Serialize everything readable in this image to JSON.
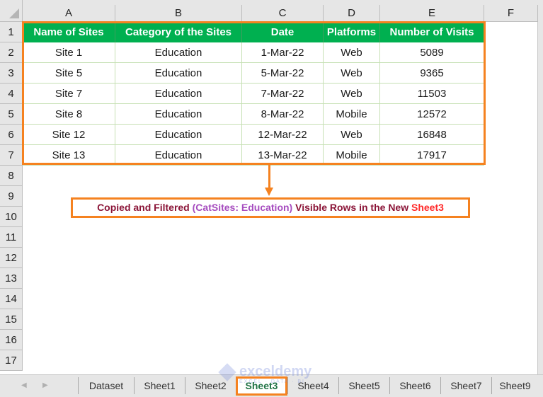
{
  "spreadsheet": {
    "columns": [
      "A",
      "B",
      "C",
      "D",
      "E",
      "F"
    ],
    "rows": [
      "1",
      "2",
      "3",
      "4",
      "5",
      "6",
      "7",
      "8",
      "9",
      "10",
      "11",
      "12",
      "13",
      "14",
      "15",
      "16",
      "17"
    ],
    "table": {
      "headers": [
        "Name of Sites",
        "Category of the Sites",
        "Date",
        "Platforms",
        "Number of Visits"
      ],
      "rows": [
        [
          "Site 1",
          "Education",
          "1-Mar-22",
          "Web",
          "5089"
        ],
        [
          "Site 5",
          "Education",
          "5-Mar-22",
          "Web",
          "9365"
        ],
        [
          "Site 7",
          "Education",
          "7-Mar-22",
          "Web",
          "11503"
        ],
        [
          "Site 8",
          "Education",
          "8-Mar-22",
          "Mobile",
          "12572"
        ],
        [
          "Site 12",
          "Education",
          "12-Mar-22",
          "Web",
          "16848"
        ],
        [
          "Site 13",
          "Education",
          "13-Mar-22",
          "Mobile",
          "17917"
        ]
      ]
    }
  },
  "callout": {
    "part1": "Copied and Filtered ",
    "part2": "(CatSites: Education)",
    "part3": " Visible Rows in the New ",
    "part4": "Sheet3"
  },
  "tabs": [
    "Dataset",
    "Sheet1",
    "Sheet2",
    "Sheet3",
    "Sheet4",
    "Sheet5",
    "Sheet6",
    "Sheet7",
    "Sheet9"
  ],
  "active_tab": "Sheet3",
  "watermark": {
    "name": "exceldemy",
    "tagline": "EXCEL · DATA · BI"
  },
  "colors": {
    "header_green": "#00b050",
    "highlight_orange": "#f58220",
    "active_tab_text": "#217346"
  }
}
